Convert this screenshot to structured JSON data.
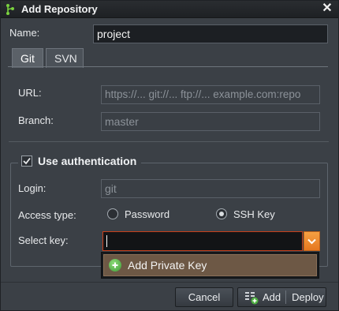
{
  "window": {
    "title": "Add Repository",
    "app_icon": "git-branch-icon",
    "close_icon": "close-icon"
  },
  "name_field": {
    "label": "Name:",
    "value": "project"
  },
  "tabs": [
    {
      "label": "Git",
      "active": true
    },
    {
      "label": "SVN",
      "active": false
    }
  ],
  "url_field": {
    "label": "URL:",
    "placeholder": "https://... git://... ftp://... example.com:repo"
  },
  "branch_field": {
    "label": "Branch:",
    "placeholder": "master"
  },
  "auth": {
    "legend": "Use authentication",
    "checked": true,
    "login": {
      "label": "Login:",
      "placeholder": "git"
    },
    "access_type": {
      "label": "Access type:",
      "options": [
        "Password",
        "SSH Key"
      ],
      "selected": "SSH Key"
    },
    "select_key": {
      "label": "Select key:",
      "value": "",
      "dropdown_items": [
        {
          "label": "Add Private Key",
          "icon": "add-circle-icon"
        }
      ]
    }
  },
  "footer": {
    "cancel": "Cancel",
    "add": "Add",
    "deploy": "Deploy",
    "deploy_icon": "deploy-icon"
  },
  "colors": {
    "accent": "#e8801f",
    "error_border": "#c8401a",
    "dropdown_highlight": "#6d5845",
    "add_green": "#4caf3f"
  }
}
